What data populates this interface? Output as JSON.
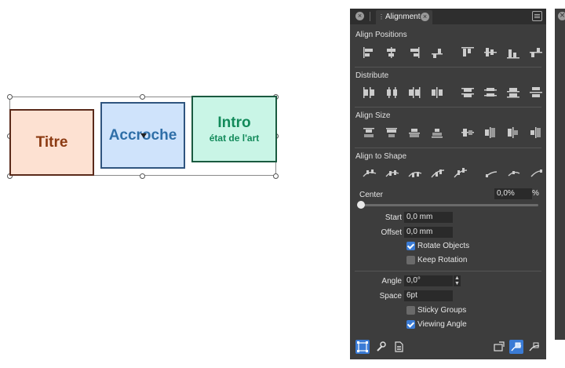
{
  "canvas": {
    "shapes": {
      "titre": "Titre",
      "accroche": "Accroche",
      "intro_title": "Intro",
      "intro_sub": "état de l'art"
    }
  },
  "panel": {
    "tab_label": "Alignment",
    "sections": {
      "align_positions": "Align Positions",
      "distribute": "Distribute",
      "align_size": "Align Size",
      "align_to_shape": "Align to Shape"
    },
    "center": {
      "label": "Center",
      "value": "0,0%",
      "unit": "%",
      "slider_fraction": 0.0
    },
    "start": {
      "label": "Start",
      "value": "0,0 mm"
    },
    "offset": {
      "label": "Offset",
      "value": "0,0 mm"
    },
    "rotate_objects": {
      "label": "Rotate Objects",
      "checked": true
    },
    "keep_rotation": {
      "label": "Keep Rotation",
      "checked": false
    },
    "angle": {
      "label": "Angle",
      "value": "0,0°"
    },
    "space": {
      "label": "Space",
      "value": "6pt"
    },
    "sticky_groups": {
      "label": "Sticky Groups",
      "checked": false
    },
    "viewing_angle": {
      "label": "Viewing Angle",
      "checked": true
    },
    "icons": {
      "align_positions": [
        "align-left-icon",
        "align-center-h-icon",
        "align-right-icon",
        "align-to-baseline-icon",
        "align-top-icon",
        "align-center-v-icon",
        "align-bottom-icon",
        "align-to-top-baseline-icon"
      ],
      "distribute": [
        "distribute-left-icon",
        "distribute-center-h-icon",
        "distribute-right-icon",
        "distribute-gap-h-icon",
        "distribute-top-icon",
        "distribute-center-v-icon",
        "distribute-bottom-icon",
        "distribute-gap-v-icon"
      ],
      "align_size": [
        "size-width-min-icon",
        "size-width-max-icon",
        "size-width-avg-icon",
        "size-width-first-icon",
        "size-height-min-icon",
        "size-height-max-icon",
        "size-height-avg-icon",
        "size-height-first-icon"
      ],
      "align_to_shape": [
        "shape-align-1-icon",
        "shape-align-2-icon",
        "shape-align-3-icon",
        "shape-align-4-icon",
        "shape-align-5-icon",
        "shape-align-6-icon",
        "shape-align-7-icon",
        "shape-align-8-icon"
      ],
      "bottom": [
        "selection-box-icon",
        "wrench-icon",
        "document-icon",
        "transform-icon",
        "align-mode-icon",
        "align-extra-icon"
      ]
    },
    "colors": {
      "panel_bg": "#3d3d3d",
      "accent": "#3a7bd5",
      "field_bg": "#2a2a2a"
    }
  }
}
